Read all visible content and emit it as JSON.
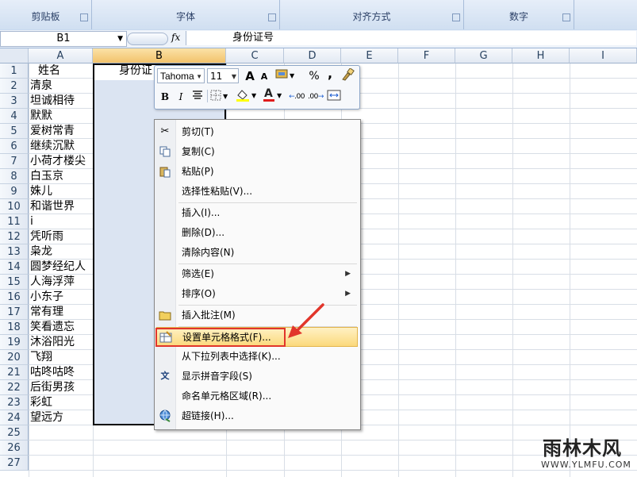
{
  "ribbon": {
    "groups": [
      "剪贴板",
      "字体",
      "对齐方式",
      "数字"
    ]
  },
  "formula_bar": {
    "name_box": "B1",
    "fx": "fx",
    "content": "身份证号"
  },
  "columns": [
    "A",
    "B",
    "C",
    "D",
    "E",
    "F",
    "G",
    "H",
    "I"
  ],
  "rows": [
    "1",
    "2",
    "3",
    "4",
    "5",
    "6",
    "7",
    "8",
    "9",
    "10",
    "11",
    "12",
    "13",
    "14",
    "15",
    "16",
    "17",
    "18",
    "19",
    "20",
    "21",
    "22",
    "23",
    "24",
    "25",
    "26",
    "27"
  ],
  "column_a": [
    "姓名",
    "清泉",
    "坦诚相待",
    "默默",
    "爱树常青",
    "继续沉默",
    "小荷才楼尖",
    "白玉京",
    "姝儿",
    "和谐世界",
    "i",
    "凭听雨",
    "枭龙",
    "圆梦经纪人",
    "人海浮萍",
    "小东子",
    "常有理",
    "笑看遗忘",
    "沐浴阳光",
    "飞翔",
    "咕咚咕咚",
    "后街男孩",
    "彩虹",
    "望远方"
  ],
  "cell_b1": "身份证",
  "mini_toolbar": {
    "font_name": "Tahoma",
    "font_size": "11",
    "grow": "A",
    "shrink": "A",
    "percent": "%",
    "comma": ",",
    "bold": "B",
    "italic": "I",
    "font_color": "A",
    "inc_decimal": ".00",
    "dec_decimal": ".00"
  },
  "context_menu": {
    "items": [
      {
        "label": "剪切(T)",
        "icon": "scissors-icon"
      },
      {
        "label": "复制(C)",
        "icon": "copy-icon"
      },
      {
        "label": "粘贴(P)",
        "icon": "paste-icon"
      },
      {
        "label": "选择性粘贴(V)...",
        "icon": ""
      },
      {
        "label": "插入(I)...",
        "icon": ""
      },
      {
        "label": "删除(D)...",
        "icon": ""
      },
      {
        "label": "清除内容(N)",
        "icon": ""
      },
      {
        "label": "筛选(E)",
        "icon": "",
        "submenu": true
      },
      {
        "label": "排序(O)",
        "icon": "",
        "submenu": true
      },
      {
        "label": "插入批注(M)",
        "icon": "comment-icon"
      },
      {
        "label": "设置单元格格式(F)...",
        "icon": "format-cells-icon",
        "highlighted": true
      },
      {
        "label": "从下拉列表中选择(K)...",
        "icon": ""
      },
      {
        "label": "显示拼音字段(S)",
        "icon": "phonetic-icon"
      },
      {
        "label": "命名单元格区域(R)...",
        "icon": ""
      },
      {
        "label": "超链接(H)...",
        "icon": "hyperlink-icon"
      }
    ]
  },
  "watermark": {
    "title": "雨林木风",
    "url": "WWW.YLMFU.COM"
  },
  "colors": {
    "highlight": "#fbd97c",
    "annotation_red": "#e1352b",
    "selection": "#dbe4f2"
  }
}
